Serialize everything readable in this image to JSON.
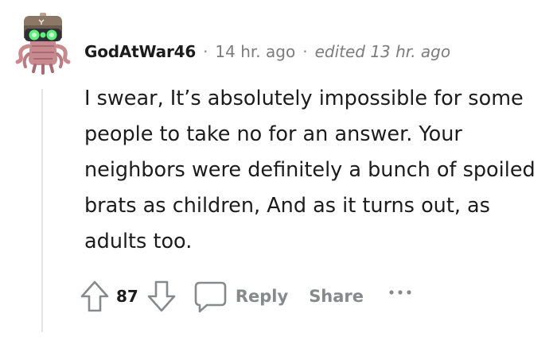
{
  "comment": {
    "author": "GodAtWar46",
    "separator": "·",
    "time": "14 hr. ago",
    "edited": "edited 13 hr. ago",
    "body": "I swear, It’s absolutely impossible for some people to take no for an answer. Your neighbors were definitely a bunch of spoiled brats as children, And as it turns out, as adults too."
  },
  "actions": {
    "vote_count": "87",
    "reply_label": "Reply",
    "share_label": "Share"
  },
  "icons": {
    "avatar": "robot-avatar-icon",
    "upvote": "upvote-arrow-icon",
    "downvote": "downvote-arrow-icon",
    "reply": "speech-bubble-icon",
    "more": "ellipsis-icon"
  },
  "colors": {
    "text": "#1c1c1c",
    "muted": "#878a8c",
    "thread_line": "#e4e4e4"
  }
}
